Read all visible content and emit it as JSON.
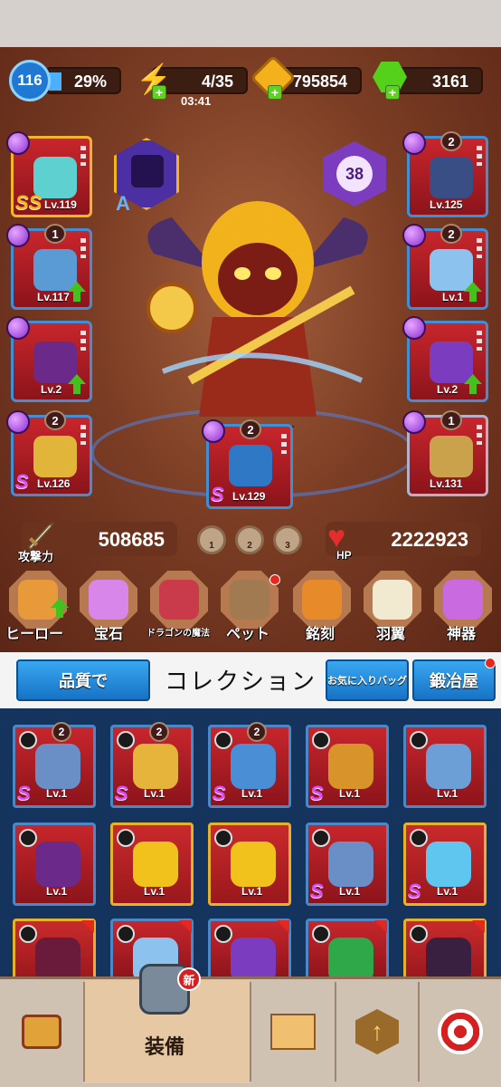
{
  "resources": {
    "level": "116",
    "xp_percent": "29%",
    "energy": "4/35",
    "energy_timer": "03:41",
    "gold": "795854",
    "gems": "3161"
  },
  "hero": {
    "rank_letter": "A",
    "level": "38"
  },
  "equipment_left": [
    {
      "level": "Lv.119",
      "grade": "SS",
      "count": ""
    },
    {
      "level": "Lv.117",
      "grade": "",
      "count": "1"
    },
    {
      "level": "Lv.2",
      "grade": "",
      "count": ""
    },
    {
      "level": "Lv.126",
      "grade": "S",
      "count": "2"
    }
  ],
  "equipment_right": [
    {
      "level": "Lv.125",
      "count": "2"
    },
    {
      "level": "Lv.1",
      "count": "2"
    },
    {
      "level": "Lv.2",
      "count": ""
    },
    {
      "level": "Lv.131",
      "count": "1"
    }
  ],
  "equipment_center": {
    "level": "Lv.129",
    "grade": "S",
    "count": "2"
  },
  "stats": {
    "attack_label": "攻撃力",
    "attack_value": "508685",
    "hp_label": "HP",
    "hp_value": "2222923",
    "presets": [
      "1",
      "2",
      "3"
    ]
  },
  "menu": [
    {
      "label": "ヒーロー"
    },
    {
      "label": "宝石"
    },
    {
      "label": "ドラゴンの魔法"
    },
    {
      "label": "ペット"
    },
    {
      "label": "銘刻"
    },
    {
      "label": "羽翼"
    },
    {
      "label": "神器"
    }
  ],
  "collection": {
    "sort_button": "品質で",
    "title": "コレクション",
    "favorites_button": "お気に入りバッグ",
    "forge_button": "鍛冶屋",
    "items": [
      {
        "level": "Lv.1",
        "grade": "S",
        "count": "2"
      },
      {
        "level": "Lv.1",
        "grade": "S",
        "count": "2"
      },
      {
        "level": "Lv.1",
        "grade": "S",
        "count": "2"
      },
      {
        "level": "Lv.1",
        "grade": "S",
        "count": ""
      },
      {
        "level": "Lv.1",
        "grade": "",
        "count": ""
      },
      {
        "level": "Lv.1",
        "grade": "",
        "count": ""
      },
      {
        "level": "Lv.1",
        "grade": "",
        "count": ""
      },
      {
        "level": "Lv.1",
        "grade": "",
        "count": ""
      },
      {
        "level": "Lv.1",
        "grade": "S",
        "count": ""
      },
      {
        "level": "Lv.1",
        "grade": "S",
        "count": ""
      }
    ]
  },
  "bottom_nav": {
    "equipment_label": "装備",
    "new_badge": "新"
  }
}
